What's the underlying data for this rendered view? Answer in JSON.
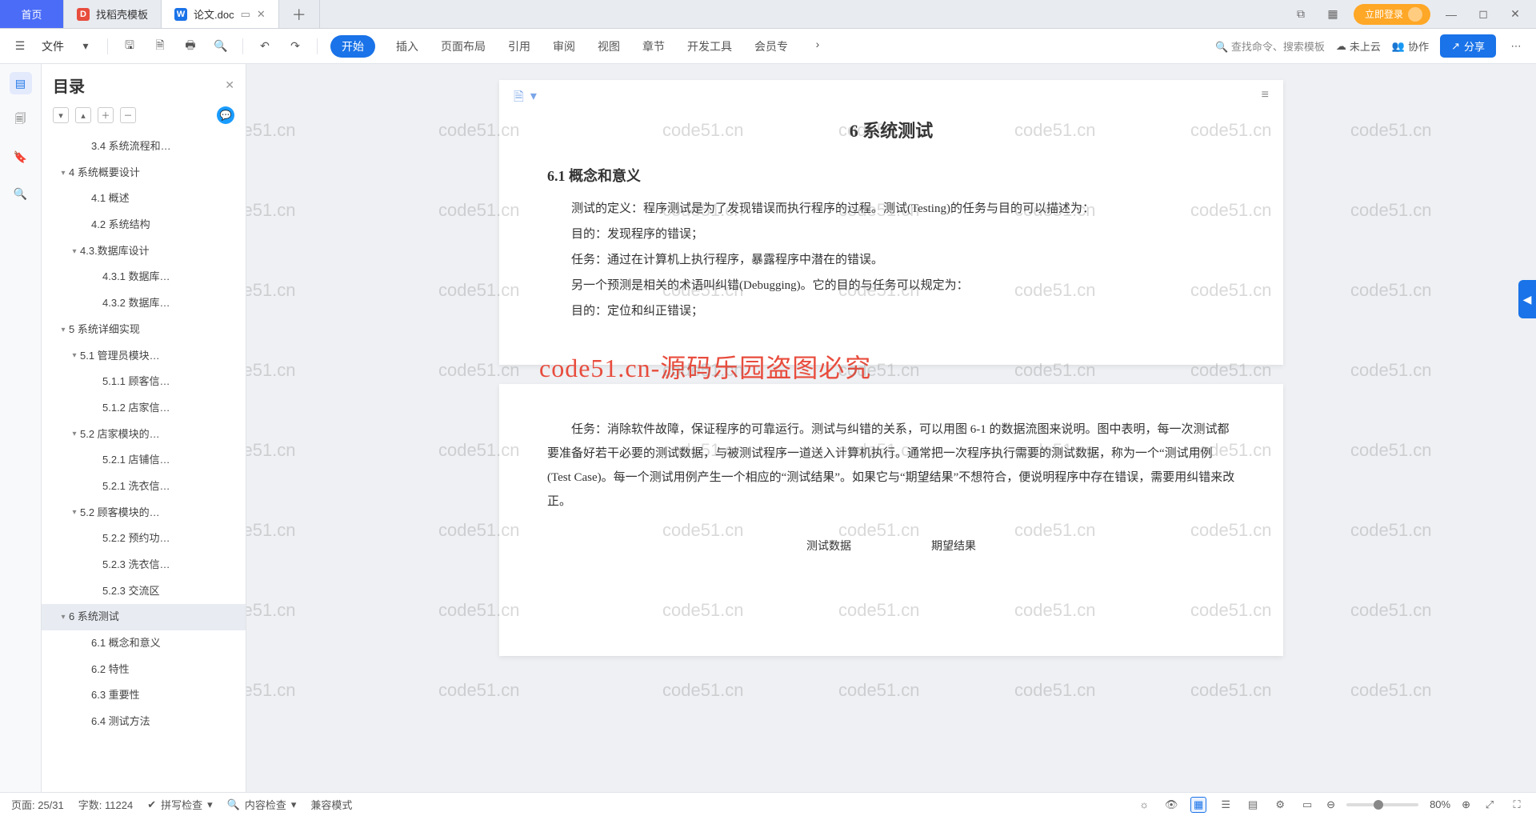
{
  "tabs": {
    "home": "首页",
    "ds_label": "找稻壳模板",
    "doc_label": "论文.doc",
    "ds_icon": "D",
    "w_icon": "W"
  },
  "topright": {
    "login": "立即登录"
  },
  "toolbar": {
    "file": "文件",
    "menus": [
      "开始",
      "插入",
      "页面布局",
      "引用",
      "审阅",
      "视图",
      "章节",
      "开发工具",
      "会员专"
    ],
    "search": "查找命令、搜索模板",
    "cloud": "未上云",
    "collab": "协作",
    "share": "分享"
  },
  "outline": {
    "title": "目录",
    "items": [
      {
        "label": "3.4 系统流程和…",
        "indent": 3,
        "exp": ""
      },
      {
        "label": "4 系统概要设计",
        "indent": 1,
        "exp": "▾"
      },
      {
        "label": "4.1 概述",
        "indent": 3,
        "exp": ""
      },
      {
        "label": "4.2 系统结构",
        "indent": 3,
        "exp": ""
      },
      {
        "label": "4.3.数据库设计",
        "indent": 2,
        "exp": "▾"
      },
      {
        "label": "4.3.1 数据库…",
        "indent": 4,
        "exp": ""
      },
      {
        "label": "4.3.2 数据库…",
        "indent": 4,
        "exp": ""
      },
      {
        "label": "5 系统详细实现",
        "indent": 1,
        "exp": "▾"
      },
      {
        "label": "5.1 管理员模块…",
        "indent": 2,
        "exp": "▾"
      },
      {
        "label": "5.1.1 顾客信…",
        "indent": 4,
        "exp": ""
      },
      {
        "label": "5.1.2 店家信…",
        "indent": 4,
        "exp": ""
      },
      {
        "label": "5.2 店家模块的…",
        "indent": 2,
        "exp": "▾"
      },
      {
        "label": "5.2.1 店铺信…",
        "indent": 4,
        "exp": ""
      },
      {
        "label": "5.2.1 洗衣信…",
        "indent": 4,
        "exp": ""
      },
      {
        "label": "5.2 顾客模块的…",
        "indent": 2,
        "exp": "▾"
      },
      {
        "label": "5.2.2 预约功…",
        "indent": 4,
        "exp": ""
      },
      {
        "label": "5.2.3 洗衣信…",
        "indent": 4,
        "exp": ""
      },
      {
        "label": "5.2.3 交流区",
        "indent": 4,
        "exp": ""
      },
      {
        "label": "6 系统测试",
        "indent": 1,
        "exp": "▾",
        "selected": true
      },
      {
        "label": "6.1 概念和意义",
        "indent": 3,
        "exp": ""
      },
      {
        "label": "6.2 特性",
        "indent": 3,
        "exp": ""
      },
      {
        "label": "6.3 重要性",
        "indent": 3,
        "exp": ""
      },
      {
        "label": "6.4 测试方法",
        "indent": 3,
        "exp": ""
      }
    ]
  },
  "doc": {
    "h1": "6 系统测试",
    "h2": "6.1 概念和意义",
    "p1": "测试的定义：程序测试是为了发现错误而执行程序的过程。测试(Testing)的任务与目的可以描述为：",
    "p2": "目的：发现程序的错误；",
    "p3": "任务：通过在计算机上执行程序，暴露程序中潜在的错误。",
    "p4": "另一个预测是相关的术语叫纠错(Debugging)。它的目的与任务可以规定为：",
    "p5": "目的：定位和纠正错误；",
    "p6": "任务：消除软件故障，保证程序的可靠运行。测试与纠错的关系，可以用图 6-1 的数据流图来说明。图中表明，每一次测试都要准备好若干必要的测试数据，与被测试程序一道送入计算机执行。通常把一次程序执行需要的测试数据，称为一个“测试用例(Test Case)。每一个测试用例产生一个相应的“测试结果”。如果它与“期望结果”不想符合，便说明程序中存在错误，需要用纠错来改正。",
    "diag1": "测试数据",
    "diag2": "期望结果"
  },
  "watermark": "code51.cn",
  "wm_red": "code51.cn-源码乐园盗图必究",
  "status": {
    "page": "页面: 25/31",
    "words": "字数: 11224",
    "spell": "拼写检查",
    "content": "内容检查",
    "compat": "兼容模式",
    "zoom": "80%"
  }
}
